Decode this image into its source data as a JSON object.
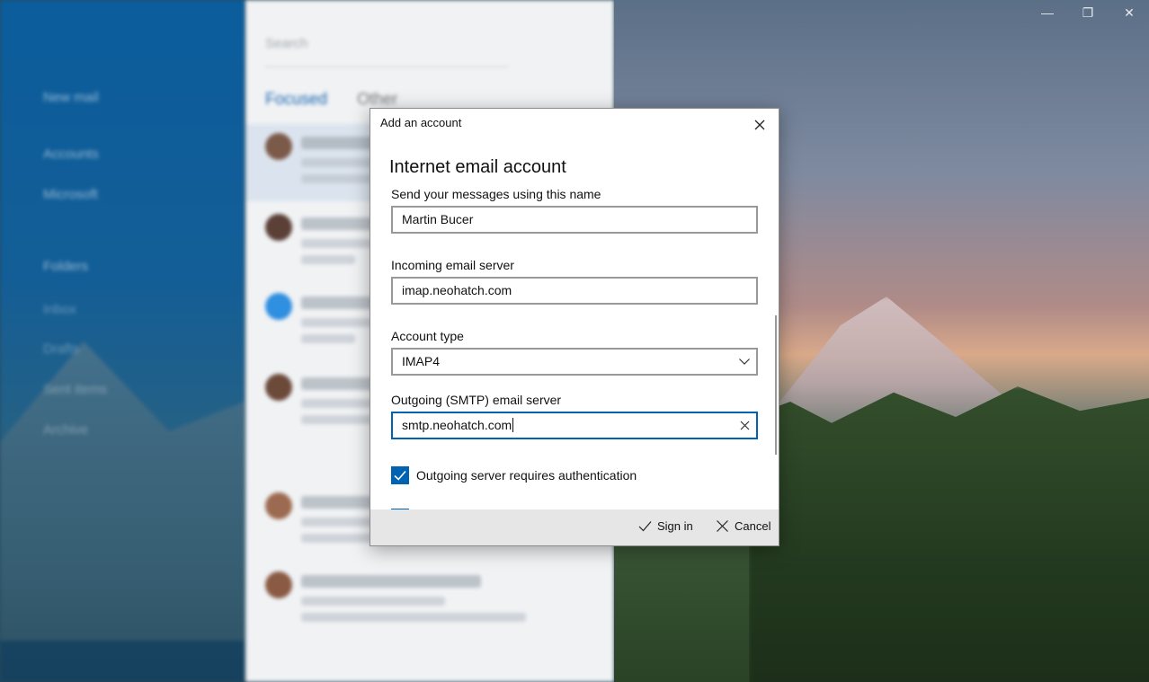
{
  "window_controls": {
    "minimize": "—",
    "restore": "❐",
    "close": "✕"
  },
  "background": {
    "nav": [
      "New mail",
      "Accounts",
      "Microsoft",
      "Folders",
      "Inbox",
      "Drafts",
      "Sent items",
      "Archive"
    ],
    "search_placeholder": "Search",
    "tabs": [
      "Focused",
      "Other"
    ]
  },
  "dialog": {
    "title": "Add an account",
    "heading": "Internet email account",
    "fields": {
      "name": {
        "label": "Send your messages using this name",
        "value": "Martin Bucer"
      },
      "incoming": {
        "label": "Incoming email server",
        "value": "imap.neohatch.com"
      },
      "account_type": {
        "label": "Account type",
        "value": "IMAP4"
      },
      "outgoing": {
        "label": "Outgoing (SMTP) email server",
        "value": "smtp.neohatch.com"
      }
    },
    "auth_checkbox": {
      "label": "Outgoing server requires authentication",
      "checked": true
    },
    "sign_in": "Sign in",
    "cancel": "Cancel"
  },
  "colors": {
    "accent": "#0063b1",
    "footer": "#e6e6e6"
  }
}
